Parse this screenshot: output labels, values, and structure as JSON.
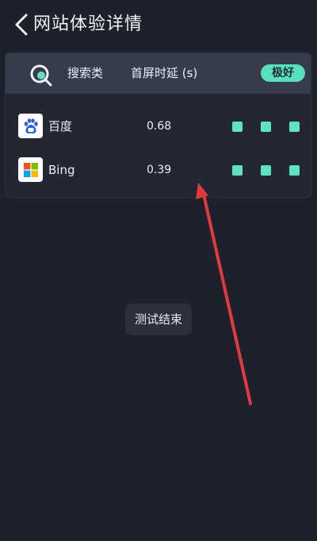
{
  "header": {
    "title": "网站体验详情",
    "back_icon": "chevron-left-icon"
  },
  "table": {
    "columns": {
      "category": "搜索类",
      "latency": "首屏时延 (s)"
    },
    "rating": "极好",
    "icon": "search-icon",
    "rows": [
      {
        "name": "百度",
        "value": "0.68",
        "logo": "baidu-logo-icon",
        "signal_level": 3,
        "signal_max": 3
      },
      {
        "name": "Bing",
        "value": "0.39",
        "logo": "microsoft-logo-icon",
        "signal_level": 3,
        "signal_max": 3
      }
    ]
  },
  "toast": {
    "text": "测试结束"
  },
  "colors": {
    "background": "#1d212c",
    "accent": "#5fe2c0",
    "annotation_arrow": "#e03a3e"
  }
}
